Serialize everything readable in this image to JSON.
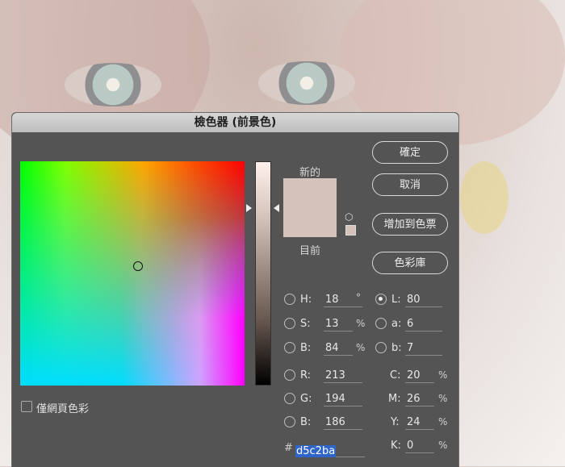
{
  "window_title": "檢色器 (前景色)",
  "labels": {
    "new": "新的",
    "current": "目前",
    "only_web": "僅網頁色彩",
    "hash": "#"
  },
  "buttons": {
    "ok": "確定",
    "cancel": "取消",
    "add_swatch": "增加到色票",
    "libraries": "色彩庫"
  },
  "hsb": {
    "h_label": "H:",
    "h": "18",
    "h_unit": "°",
    "s_label": "S:",
    "s": "13",
    "s_unit": "%",
    "b_label": "B:",
    "b": "84",
    "b_unit": "%"
  },
  "rgb": {
    "r_label": "R:",
    "r": "213",
    "g_label": "G:",
    "g": "194",
    "b_label": "B:",
    "b": "186"
  },
  "lab": {
    "l_label": "L:",
    "l": "80",
    "a_label": "a:",
    "a": "6",
    "b_label": "b:",
    "b": "7"
  },
  "cmyk": {
    "c_label": "C:",
    "c": "20",
    "c_unit": "%",
    "m_label": "M:",
    "m": "26",
    "m_unit": "%",
    "y_label": "Y:",
    "y": "24",
    "y_unit": "%",
    "k_label": "K:",
    "k": "0",
    "k_unit": "%"
  },
  "hex_value": "d5c2ba",
  "colors": {
    "selected": "#d5c2ba",
    "dialog_bg": "#545454",
    "selection_highlight": "#2f64c8"
  }
}
